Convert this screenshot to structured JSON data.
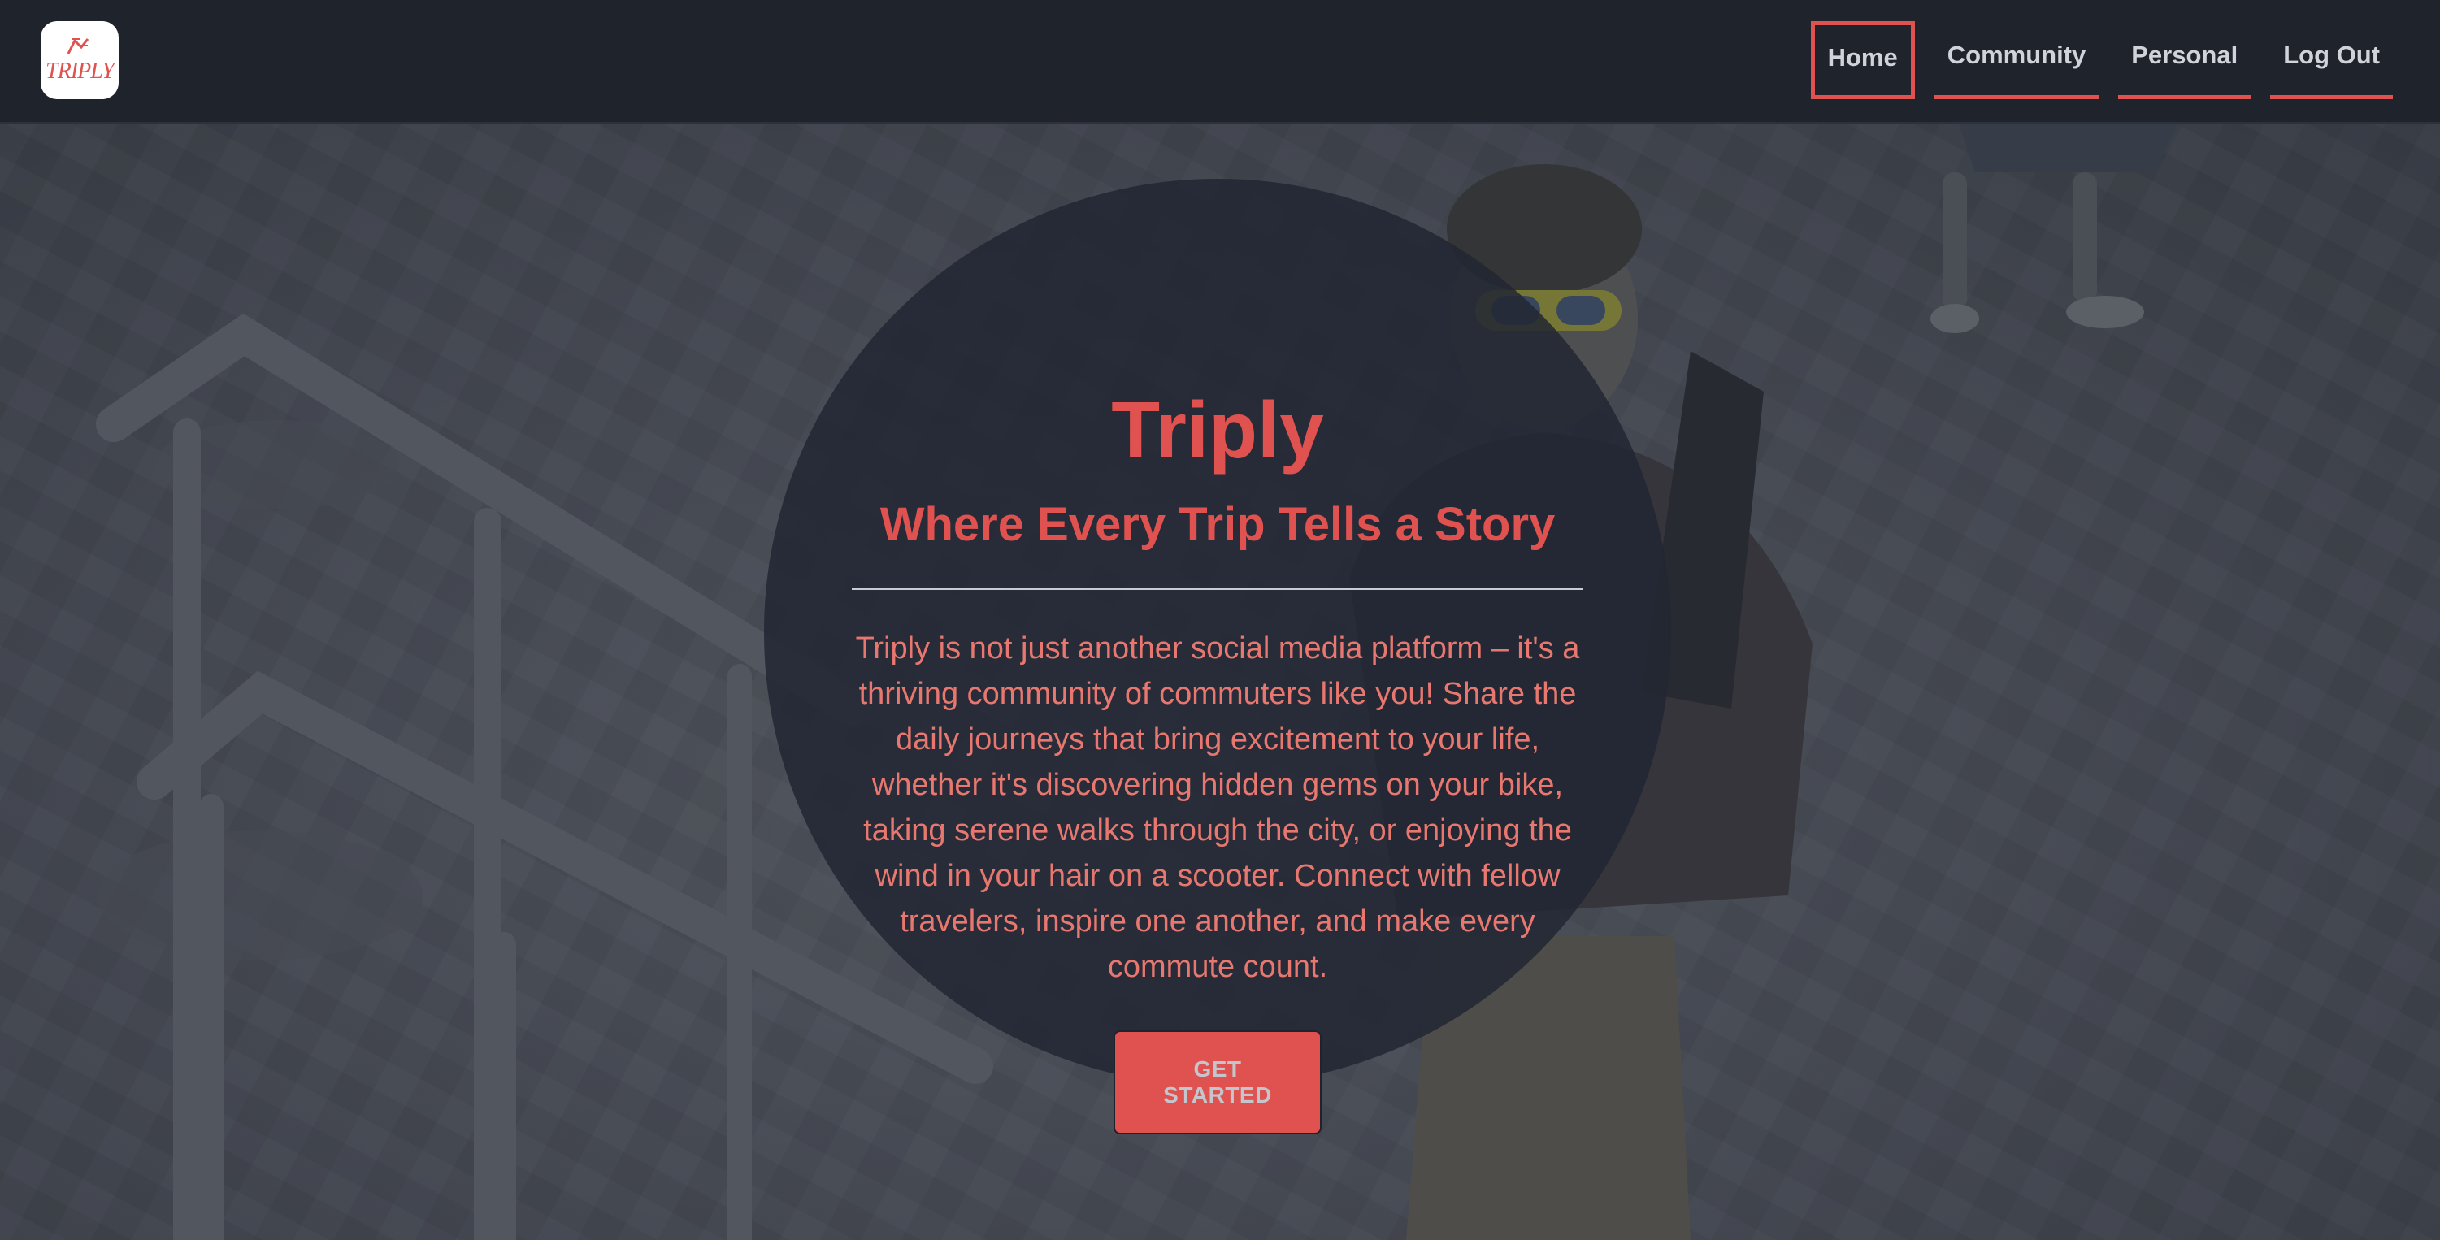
{
  "brand": {
    "logo_text": "TRIPLY"
  },
  "nav": {
    "items": [
      {
        "label": "Home",
        "active": true
      },
      {
        "label": "Community",
        "active": false
      },
      {
        "label": "Personal",
        "active": false
      },
      {
        "label": "Log Out",
        "active": false
      }
    ]
  },
  "hero": {
    "title": "Triply",
    "tagline": "Where Every Trip Tells a Story",
    "description": "Triply is not just another social media platform – it's a thriving community of commuters like you! Share the daily journeys that bring excitement to your life, whether it's discovering hidden gems on your bike, taking serene walks through the city, or enjoying the wind in your hair on a scooter. Connect with fellow travelers, inspire one another, and make every commute count.",
    "cta_label": "GET STARTED"
  },
  "colors": {
    "accent": "#e0524f",
    "navbar_bg": "#1f232c",
    "circle_bg": "#222733"
  }
}
